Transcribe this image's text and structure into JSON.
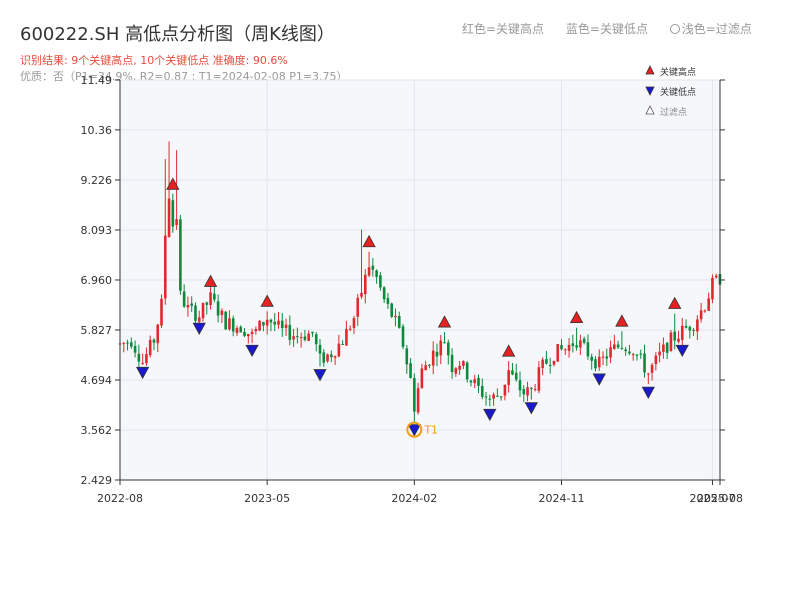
{
  "header": {
    "title": "600222.SH 高低点分析图（周K线图）",
    "result": "识别结果: 9个关键高点, 10个关键低点  准确度: 90.6%",
    "quality": "优质：否（P1=34.9%, R2=0.87 ; T1=2024-02-08 P1=3.75）",
    "legend_red": "红色=关键高点",
    "legend_blue": "蓝色=关键低点",
    "legend_light": "浅色=过滤点"
  },
  "colors": {
    "up": "#e0282e",
    "down": "#0a8a3c",
    "high_marker": "#e52121",
    "low_marker": "#1a1acc",
    "t1": "#f39c12",
    "plot_bg": "#f5f7fa",
    "grid": "#e1e6ee"
  },
  "chart_data": {
    "type": "candlestick",
    "ylim": [
      2.429,
      11.49
    ],
    "yticks": [
      "2.429",
      "3.562",
      "4.694",
      "5.827",
      "6.960",
      "8.093",
      "9.226",
      "10.36",
      "11.49"
    ],
    "xlim_week_index": [
      0,
      159
    ],
    "xticks": [
      {
        "label": "2022-08",
        "week": 0
      },
      {
        "label": "2023-05",
        "week": 39
      },
      {
        "label": "2024-02",
        "week": 78
      },
      {
        "label": "2024-11",
        "week": 117
      },
      {
        "label": "2025-07",
        "week": 157
      },
      {
        "label": "2025-08",
        "week": 159
      }
    ],
    "legend": {
      "position": "top-right",
      "items": [
        {
          "label": "关键高点",
          "symbol": "triangle-up",
          "color": "red"
        },
        {
          "label": "关键低点",
          "symbol": "triangle-down",
          "color": "blue"
        },
        {
          "label": "过滤点",
          "symbol": "triangle-up",
          "color": "light"
        }
      ]
    },
    "key_points": [
      {
        "type": "low",
        "week": 6,
        "price": 5.05
      },
      {
        "type": "high",
        "week": 14,
        "price": 8.9
      },
      {
        "type": "low",
        "week": 21,
        "price": 6.05
      },
      {
        "type": "high",
        "week": 24,
        "price": 6.7
      },
      {
        "type": "low",
        "week": 35,
        "price": 5.55
      },
      {
        "type": "high",
        "week": 39,
        "price": 6.25
      },
      {
        "type": "low",
        "week": 53,
        "price": 5.0
      },
      {
        "type": "high",
        "week": 66,
        "price": 7.6
      },
      {
        "type": "low",
        "week": 78,
        "price": 3.75,
        "label": "T1"
      },
      {
        "type": "high",
        "week": 86,
        "price": 5.78
      },
      {
        "type": "low",
        "week": 98,
        "price": 4.1
      },
      {
        "type": "high",
        "week": 103,
        "price": 5.12
      },
      {
        "type": "low",
        "week": 109,
        "price": 4.25
      },
      {
        "type": "high",
        "week": 121,
        "price": 5.88
      },
      {
        "type": "low",
        "week": 127,
        "price": 4.9
      },
      {
        "type": "high",
        "week": 133,
        "price": 5.8
      },
      {
        "type": "low",
        "week": 140,
        "price": 4.6
      },
      {
        "type": "high",
        "week": 147,
        "price": 6.2
      },
      {
        "type": "low",
        "week": 149,
        "price": 5.55
      }
    ],
    "t1_label": "T1",
    "price_path": [
      [
        0,
        5.5
      ],
      [
        3,
        5.6
      ],
      [
        6,
        5.1
      ],
      [
        9,
        5.6
      ],
      [
        11,
        6.4
      ],
      [
        12,
        8.0
      ],
      [
        13,
        8.9
      ],
      [
        14,
        8.2
      ],
      [
        15,
        8.4
      ],
      [
        16,
        6.6
      ],
      [
        18,
        6.3
      ],
      [
        21,
        6.15
      ],
      [
        24,
        6.55
      ],
      [
        28,
        6.0
      ],
      [
        32,
        5.9
      ],
      [
        35,
        5.7
      ],
      [
        39,
        6.1
      ],
      [
        43,
        5.8
      ],
      [
        47,
        5.7
      ],
      [
        51,
        5.75
      ],
      [
        53,
        5.15
      ],
      [
        56,
        5.3
      ],
      [
        59,
        5.6
      ],
      [
        62,
        6.1
      ],
      [
        64,
        6.7
      ],
      [
        66,
        7.3
      ],
      [
        68,
        7.0
      ],
      [
        70,
        6.5
      ],
      [
        73,
        6.0
      ],
      [
        75,
        5.5
      ],
      [
        77,
        4.7
      ],
      [
        78,
        4.1
      ],
      [
        80,
        4.9
      ],
      [
        83,
        5.3
      ],
      [
        86,
        5.6
      ],
      [
        88,
        5.0
      ],
      [
        90,
        5.1
      ],
      [
        93,
        4.7
      ],
      [
        96,
        4.4
      ],
      [
        98,
        4.25
      ],
      [
        101,
        4.4
      ],
      [
        103,
        4.9
      ],
      [
        105,
        4.6
      ],
      [
        107,
        4.4
      ],
      [
        109,
        4.45
      ],
      [
        112,
        5.0
      ],
      [
        115,
        5.3
      ],
      [
        118,
        5.4
      ],
      [
        121,
        5.6
      ],
      [
        124,
        5.3
      ],
      [
        127,
        5.05
      ],
      [
        130,
        5.35
      ],
      [
        133,
        5.5
      ],
      [
        136,
        5.4
      ],
      [
        140,
        4.85
      ],
      [
        143,
        5.25
      ],
      [
        146,
        5.6
      ],
      [
        149,
        5.8
      ],
      [
        152,
        6.0
      ],
      [
        155,
        6.4
      ],
      [
        157,
        6.85
      ],
      [
        159,
        7.0
      ]
    ]
  }
}
